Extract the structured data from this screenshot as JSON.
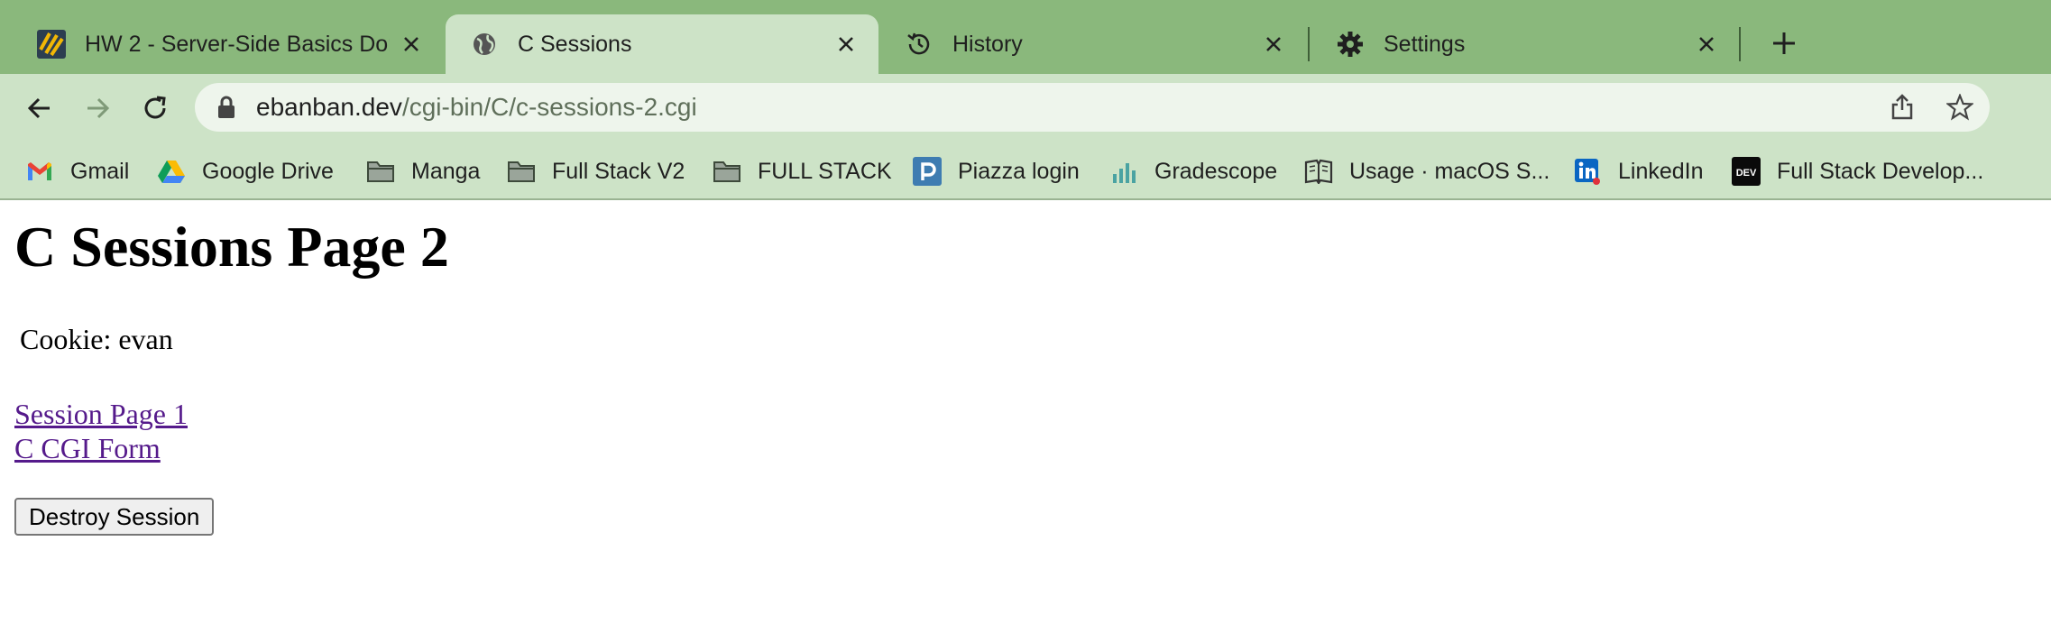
{
  "tabs": [
    {
      "title": "HW 2 - Server-Side Basics Dor",
      "icon": "hw-favicon-icon",
      "active": false
    },
    {
      "title": "C Sessions",
      "icon": "globe-icon",
      "active": true
    },
    {
      "title": "History",
      "icon": "history-icon",
      "active": false
    },
    {
      "title": "Settings",
      "icon": "gear-icon",
      "active": false
    }
  ],
  "address": {
    "domain": "ebanban.dev",
    "path": "/cgi-bin/C/c-sessions-2.cgi"
  },
  "bookmarks": [
    {
      "label": "Gmail",
      "icon": "gmail-icon"
    },
    {
      "label": "Google Drive",
      "icon": "google-drive-icon"
    },
    {
      "label": "Manga",
      "icon": "folder-icon"
    },
    {
      "label": "Full Stack V2",
      "icon": "folder-icon"
    },
    {
      "label": "FULL STACK",
      "icon": "folder-icon"
    },
    {
      "label": "Piazza login",
      "icon": "piazza-icon"
    },
    {
      "label": "Gradescope",
      "icon": "gradescope-icon"
    },
    {
      "label": "Usage · macOS S...",
      "icon": "book-icon"
    },
    {
      "label": "LinkedIn",
      "icon": "linkedin-icon"
    },
    {
      "label": "Full Stack Develop...",
      "icon": "dev-icon"
    }
  ],
  "page": {
    "heading": "C Sessions Page 2",
    "cookie_text": "Cookie: evan",
    "links": [
      "Session Page 1",
      "C CGI Form"
    ],
    "button_label": "Destroy Session"
  },
  "colors": {
    "tabstrip": "#8ab87c",
    "toolbar": "#cde3c7",
    "link_visited": "#551a8b"
  }
}
